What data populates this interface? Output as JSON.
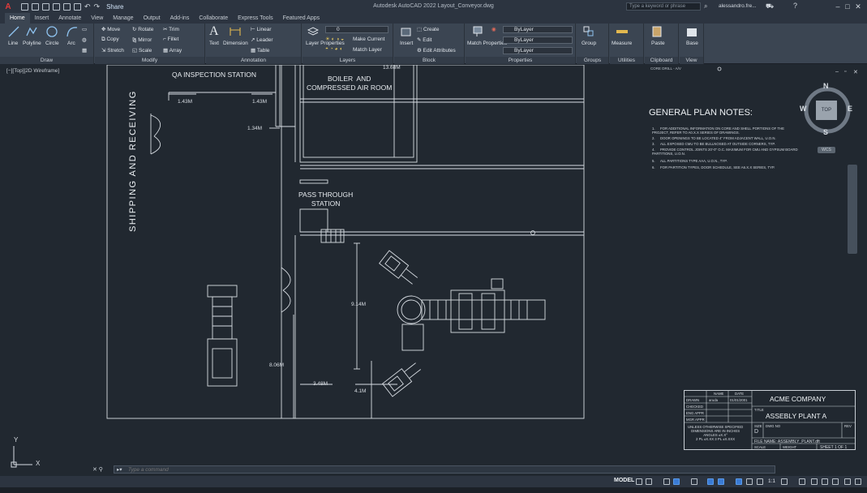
{
  "app": {
    "title": "Autodesk AutoCAD 2022    Layout_Conveyor.dwg",
    "share_label": "Share",
    "search_placeholder": "Type a keyword or phrase",
    "user": "alessandro.fre...",
    "logo": "A"
  },
  "tabs": [
    "Home",
    "Insert",
    "Annotate",
    "View",
    "Manage",
    "Output",
    "Add-ins",
    "Collaborate",
    "Express Tools",
    "Featured Apps"
  ],
  "active_tab": "Home",
  "ribbon": {
    "draw": {
      "title": "Draw",
      "line": "Line",
      "polyline": "Polyline",
      "circle": "Circle",
      "arc": "Arc"
    },
    "modify": {
      "title": "Modify",
      "move": "Move",
      "rotate": "Rotate",
      "trim": "Trim",
      "copy": "Copy",
      "mirror": "Mirror",
      "fillet": "Fillet",
      "stretch": "Stretch",
      "scale": "Scale",
      "array": "Array"
    },
    "annotation": {
      "title": "Annotation",
      "text": "Text",
      "dimension": "Dimension",
      "linear": "Linear",
      "leader": "Leader",
      "table": "Table"
    },
    "layers": {
      "title": "Layers",
      "layer_properties": "Layer Properties",
      "layer_value": "0",
      "make_current": "Make Current",
      "match_layer": "Match Layer"
    },
    "block": {
      "title": "Block",
      "insert": "Insert",
      "create": "Create",
      "edit": "Edit",
      "edit_attributes": "Edit Attributes"
    },
    "properties": {
      "title": "Properties",
      "match_properties": "Match Properties",
      "color": "ByLayer",
      "linetype": "ByLayer",
      "lineweight": "ByLayer"
    },
    "groups": {
      "title": "Groups",
      "group": "Group"
    },
    "utilities": {
      "title": "Utilities",
      "measure": "Measure"
    },
    "clipboard": {
      "title": "Clipboard",
      "paste": "Paste"
    },
    "view": {
      "title": "View",
      "base": "Base"
    }
  },
  "viewport": {
    "label": "[−][Top][2D Wireframe]",
    "core_drill": "CORE DRILL - A/V"
  },
  "plan": {
    "shipping": "SHIPPING  AND  RECEIVING",
    "qa_station": "QA INSPECTION STATION",
    "boiler": "BOILER  AND\nCOMPRESSED AIR ROOM",
    "pass_through": "PASS THROUGH\nSTATION",
    "dims": {
      "d1": "1.43M",
      "d2": "1.43M",
      "d3": "1.34M",
      "d4": "13.68M",
      "d5": "9.14M",
      "d6": "8.06M",
      "d7": "3.48M",
      "d8": "4.1M"
    }
  },
  "notes": {
    "title": "GENERAL PLAN NOTES:",
    "items": [
      "FOR ADDITIONAL INFORMATION ON CORE AND SHELL PORTIONS OF THE PROJECT, REFER TO A0.X.X SERIES OF DRAWINGS.",
      "DOOR OPENINGS TO BE LOCATED 4\" FROM ADJACENT WALL, U.O.N.",
      "ALL EXPOSED CMU TO BE BULLNOSED AT OUTSIDE CORNERS, TYP.",
      "PROVIDE CONTROL JOINTS 20'-0\" O.C. MAXIMUM FOR CMU AND GYPSUM BOARD PARTITIONS, U.O.N.",
      "ALL PARTITIONS TYPE AAA, U.O.N., TYP.",
      "FOR PARTITION TYPES, DOOR SCHEDULE, SEE A6.X.X SERIES, TYP."
    ]
  },
  "viewcube": {
    "n": "N",
    "s": "S",
    "e": "E",
    "w": "W",
    "top": "TOP",
    "wcs": "WCS"
  },
  "title_block": {
    "name_hdr": "NAME",
    "date_hdr": "DATE",
    "drawn": "DRAWN",
    "drawn_name": "aruda",
    "drawn_date": "01/01/2001",
    "checked": "CHECKED",
    "eng_appr": "ENG APPR",
    "mgr_appr": "MGR APPR",
    "company": "ACME COMPANY",
    "title_lbl": "TITLE",
    "title": "ASSEBLY PLANT A",
    "tolerance": "UNLESS OTHERWISE SPECIFIED\nDIMENSIONS ARE IN INCHES\nANGLES ±X.X°\n2 PL ±X.XX 3 PL ±X.XXX",
    "size_lbl": "SIZE",
    "size": "D",
    "dwg_no": "DWG NO",
    "rev": "REV",
    "file_name": "FILE NAME: ASSEMBLY_PLANT.dft",
    "scale": "SCALE",
    "weight": "WEIGHT",
    "sheet": "SHEET 1 OF 1"
  },
  "ucs": {
    "x": "X",
    "y": "Y"
  },
  "command": {
    "placeholder": "Type a command",
    "prefix": "▸▾"
  },
  "status": {
    "model": "MODEL",
    "scale": "1:1"
  }
}
